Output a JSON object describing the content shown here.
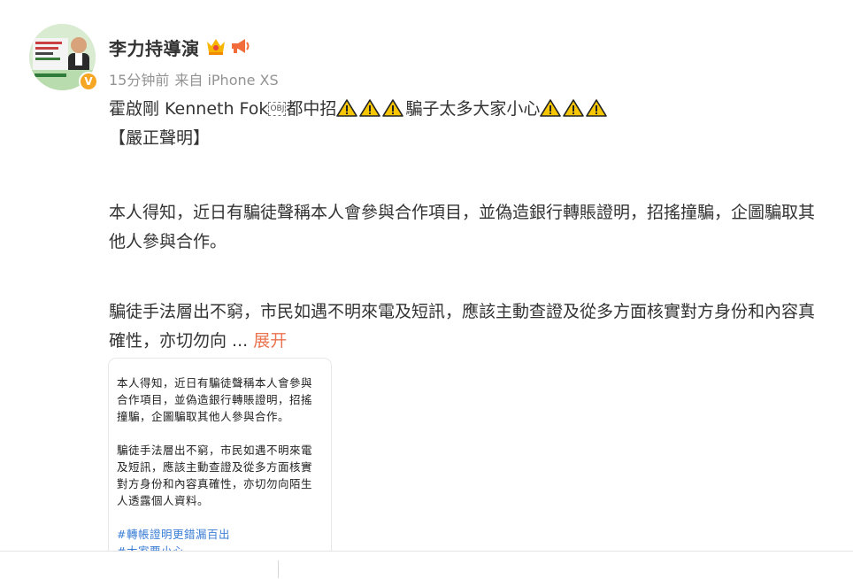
{
  "author": {
    "name": "李力持導演",
    "badges": [
      "vip-crown-icon",
      "megaphone-icon"
    ]
  },
  "meta": {
    "time": "15分钟前",
    "source": "来自 iPhone XS"
  },
  "post": {
    "title_part1": "霍啟剛 Kenneth Fok",
    "obj_marker": "OBJ",
    "title_part2": "都中招",
    "title_part3": "騙子太多大家小心",
    "heading": "【嚴正聲明】",
    "para1": "本人得知，近日有騙徒聲稱本人會參與合作項目，並偽造銀行轉賬證明，招搖撞騙，企圖騙取其他人參與合作。",
    "para2": "騙徒手法層出不窮，市民如遇不明來電及短訊，應該主動查證及從多方面核實對方身份和內容真確性，亦切勿向 ...",
    "expand_label": "展开"
  },
  "image": {
    "line1": "本人得知，近日有騙徒聲稱本人會參與合作項目，並偽造銀行轉賬證明，招搖撞騙，企圖騙取其他人參與合作。",
    "line2": "騙徒手法層出不窮，市民如遇不明來電及短訊，應該主動查證及從多方面核實對方身份和內容真確性，亦切勿向陌生人透露個人資料。",
    "hashtag1": "#轉帳證明更錯漏百出",
    "hashtag2": "#大家要小心"
  },
  "colors": {
    "link": "#eb7350",
    "hashtag": "#3b7ed6",
    "warning": "#f7c600"
  }
}
